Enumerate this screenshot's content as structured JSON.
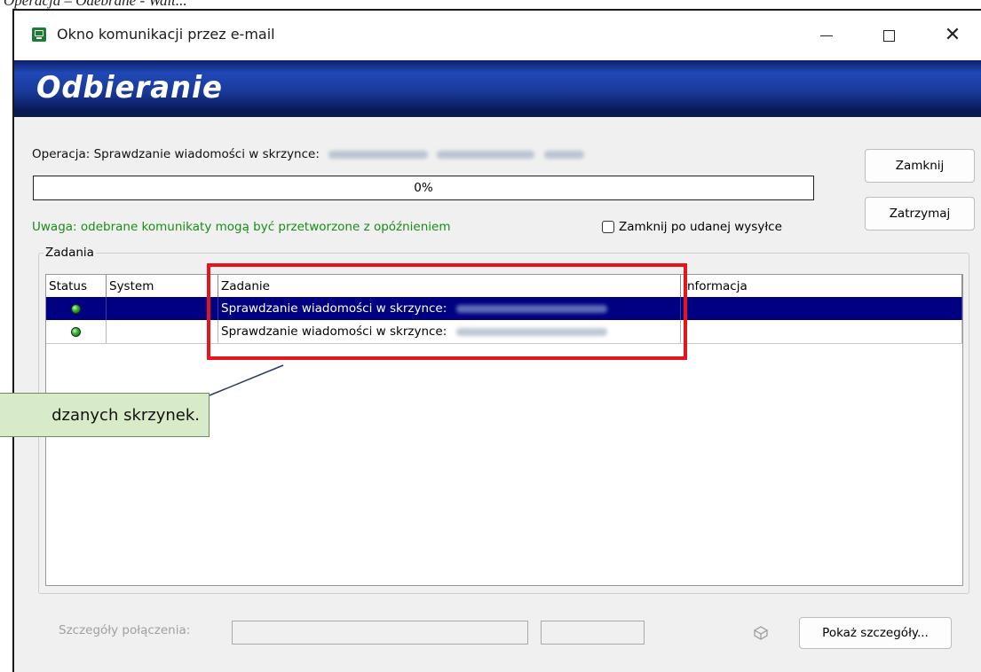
{
  "document_caption": "Operacja – Odebrane - Wait...",
  "window": {
    "title": "Okno komunikacji przez e-mail",
    "buttons": {
      "minimize": "—",
      "maximize": "☐",
      "close": "✕"
    }
  },
  "banner": {
    "title": "Odbieranie"
  },
  "operation": {
    "prefix": "Operacja: Sprawdzanie wiadomości w skrzynce:",
    "redacted": true
  },
  "progress": {
    "label": "0%",
    "value": 0
  },
  "warning": "Uwaga: odebrane komunikaty mogą być przetworzone z opóźnieniem",
  "checkbox": {
    "label": "Zamknij po udanej wysyłce",
    "checked": false
  },
  "side_buttons": {
    "close": "Zamknij",
    "stop": "Zatrzymaj"
  },
  "tasks": {
    "group_label": "Zadania",
    "columns": [
      "Status",
      "System",
      "Zadanie",
      "Informacja"
    ],
    "rows": [
      {
        "status": "active",
        "system": "",
        "task": "Sprawdzanie wiadomości w skrzynce:",
        "info": "",
        "selected": true
      },
      {
        "status": "active",
        "system": "",
        "task": "Sprawdzanie wiadomości w skrzynce:",
        "info": "",
        "selected": false
      }
    ]
  },
  "callout": {
    "text": "dzanych skrzynek."
  },
  "details": {
    "label": "Szczegóły połączenia:",
    "field1": "",
    "field2": "",
    "button": "Pokaż szczegóły..."
  },
  "colors": {
    "banner_dark": "#0a1a4a",
    "banner_mid": "#2048b6",
    "selection": "#000080",
    "warning_green": "#1c8a1c",
    "highlight_red": "#e8141c",
    "callout_bg": "#d8ebc8",
    "led_green": "#3bb33b"
  },
  "icons": {
    "app": "email-window-icon",
    "status": "green-led-icon",
    "connection": "network-connection-icon"
  }
}
